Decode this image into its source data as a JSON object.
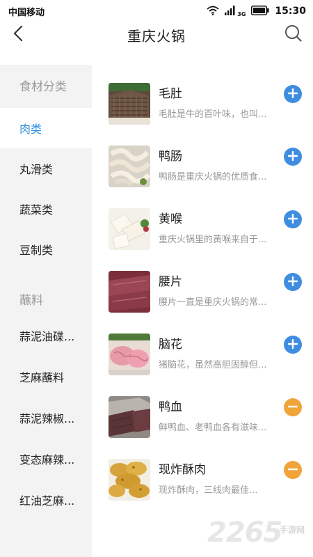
{
  "status_bar": {
    "carrier": "中国移动",
    "network": "3G",
    "time": "15:30"
  },
  "header": {
    "title": "重庆火锅"
  },
  "sidebar": {
    "items": [
      {
        "label": "食材分类"
      },
      {
        "label": "肉类"
      },
      {
        "label": "丸滑类"
      },
      {
        "label": "蔬菜类"
      },
      {
        "label": "豆制类"
      },
      {
        "label": "蘸料"
      },
      {
        "label": "蒜泥油碟..."
      },
      {
        "label": "芝麻蘸料"
      },
      {
        "label": "蒜泥辣椒..."
      },
      {
        "label": "变态麻辣..."
      },
      {
        "label": "红油芝麻..."
      }
    ],
    "active_label": "肉类"
  },
  "food_list": [
    {
      "name": "毛肚",
      "desc": "毛肚是牛的百叶味，也叫...",
      "action": "add"
    },
    {
      "name": "鸭肠",
      "desc": "鸭肠是重庆火锅的优质食...",
      "action": "add"
    },
    {
      "name": "黄喉",
      "desc": "重庆火锅里的黄喉来自于...",
      "action": "add"
    },
    {
      "name": "腰片",
      "desc": "腰片一直是重庆火锅的常...",
      "action": "add"
    },
    {
      "name": "脑花",
      "desc": "猪脑花，虽然高胆固醇但...",
      "action": "add"
    },
    {
      "name": "鸭血",
      "desc": "鲜鸭血、老鸭血各有滋味...",
      "action": "remove"
    },
    {
      "name": "现炸酥肉",
      "desc": "现炸酥肉，三线肉最佳...",
      "action": "remove"
    }
  ],
  "colors": {
    "accent_blue": "#2e8fe0",
    "add_button": "#3f8de0",
    "remove_button": "#f0a43a",
    "sidebar_bg": "#f3f3f3"
  },
  "watermark": {
    "number": "2265",
    "text": "手游网"
  }
}
